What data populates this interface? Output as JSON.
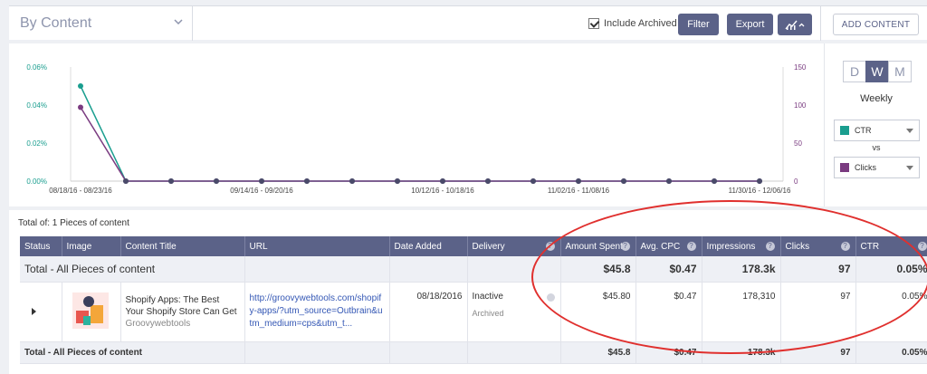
{
  "toolbar": {
    "view_select": "By Content",
    "include_archived": "Include Archived",
    "filter": "Filter",
    "export": "Export",
    "add_content": "ADD CONTENT"
  },
  "side": {
    "period_d": "D",
    "period_w": "W",
    "period_m": "M",
    "period_label": "Weekly",
    "metric1": "CTR",
    "metric1_color": "#1a9e8f",
    "vs": "vs",
    "metric2": "Clicks",
    "metric2_color": "#7a3b80"
  },
  "chart_data": {
    "type": "line",
    "left_axis_ticks": [
      "0.00%",
      "0.02%",
      "0.04%",
      "0.06%"
    ],
    "right_axis_ticks": [
      "0",
      "50",
      "100",
      "150"
    ],
    "left_ylim": [
      0,
      0.06
    ],
    "right_ylim": [
      0,
      150
    ],
    "x_labels": [
      "08/18/16 - 08/23/16",
      "09/14/16 - 09/20/16",
      "10/12/16 - 10/18/16",
      "11/02/16 - 11/08/16",
      "11/30/16 - 12/06/16"
    ],
    "num_points": 16,
    "series": [
      {
        "name": "CTR",
        "axis": "left",
        "color": "#1a9e8f",
        "values": [
          0.05,
          0,
          0,
          0,
          0,
          0,
          0,
          0,
          0,
          0,
          0,
          0,
          0,
          0,
          0,
          0
        ]
      },
      {
        "name": "Clicks",
        "axis": "right",
        "color": "#7a3b80",
        "values": [
          97,
          0,
          0,
          0,
          0,
          0,
          0,
          0,
          0,
          0,
          0,
          0,
          0,
          0,
          0,
          0
        ]
      }
    ]
  },
  "table": {
    "total_of": "Total of: 1 Pieces of content",
    "headers": [
      "Status",
      "Image",
      "Content Title",
      "URL",
      "Date Added",
      "Delivery",
      "Amount Spent",
      "Avg. CPC",
      "Impressions",
      "Clicks",
      "CTR"
    ],
    "total_row": {
      "label": "Total - All Pieces of content",
      "amount": "$45.8",
      "cpc": "$0.47",
      "impressions": "178.3k",
      "clicks": "97",
      "ctr": "0.05%"
    },
    "row": {
      "title": "Shopify Apps: The Best Your Shopify Store Can Get",
      "source": "Groovywebtools",
      "url": "http://groovywebtools.com/shopify-apps/?utm_source=Outbrain&utm_medium=cps&utm_t...",
      "date": "08/18/2016",
      "delivery": "Inactive",
      "delivery_sub": "Archived",
      "amount": "$45.80",
      "cpc": "$0.47",
      "impressions": "178,310",
      "clicks": "97",
      "ctr": "0.05%"
    }
  }
}
